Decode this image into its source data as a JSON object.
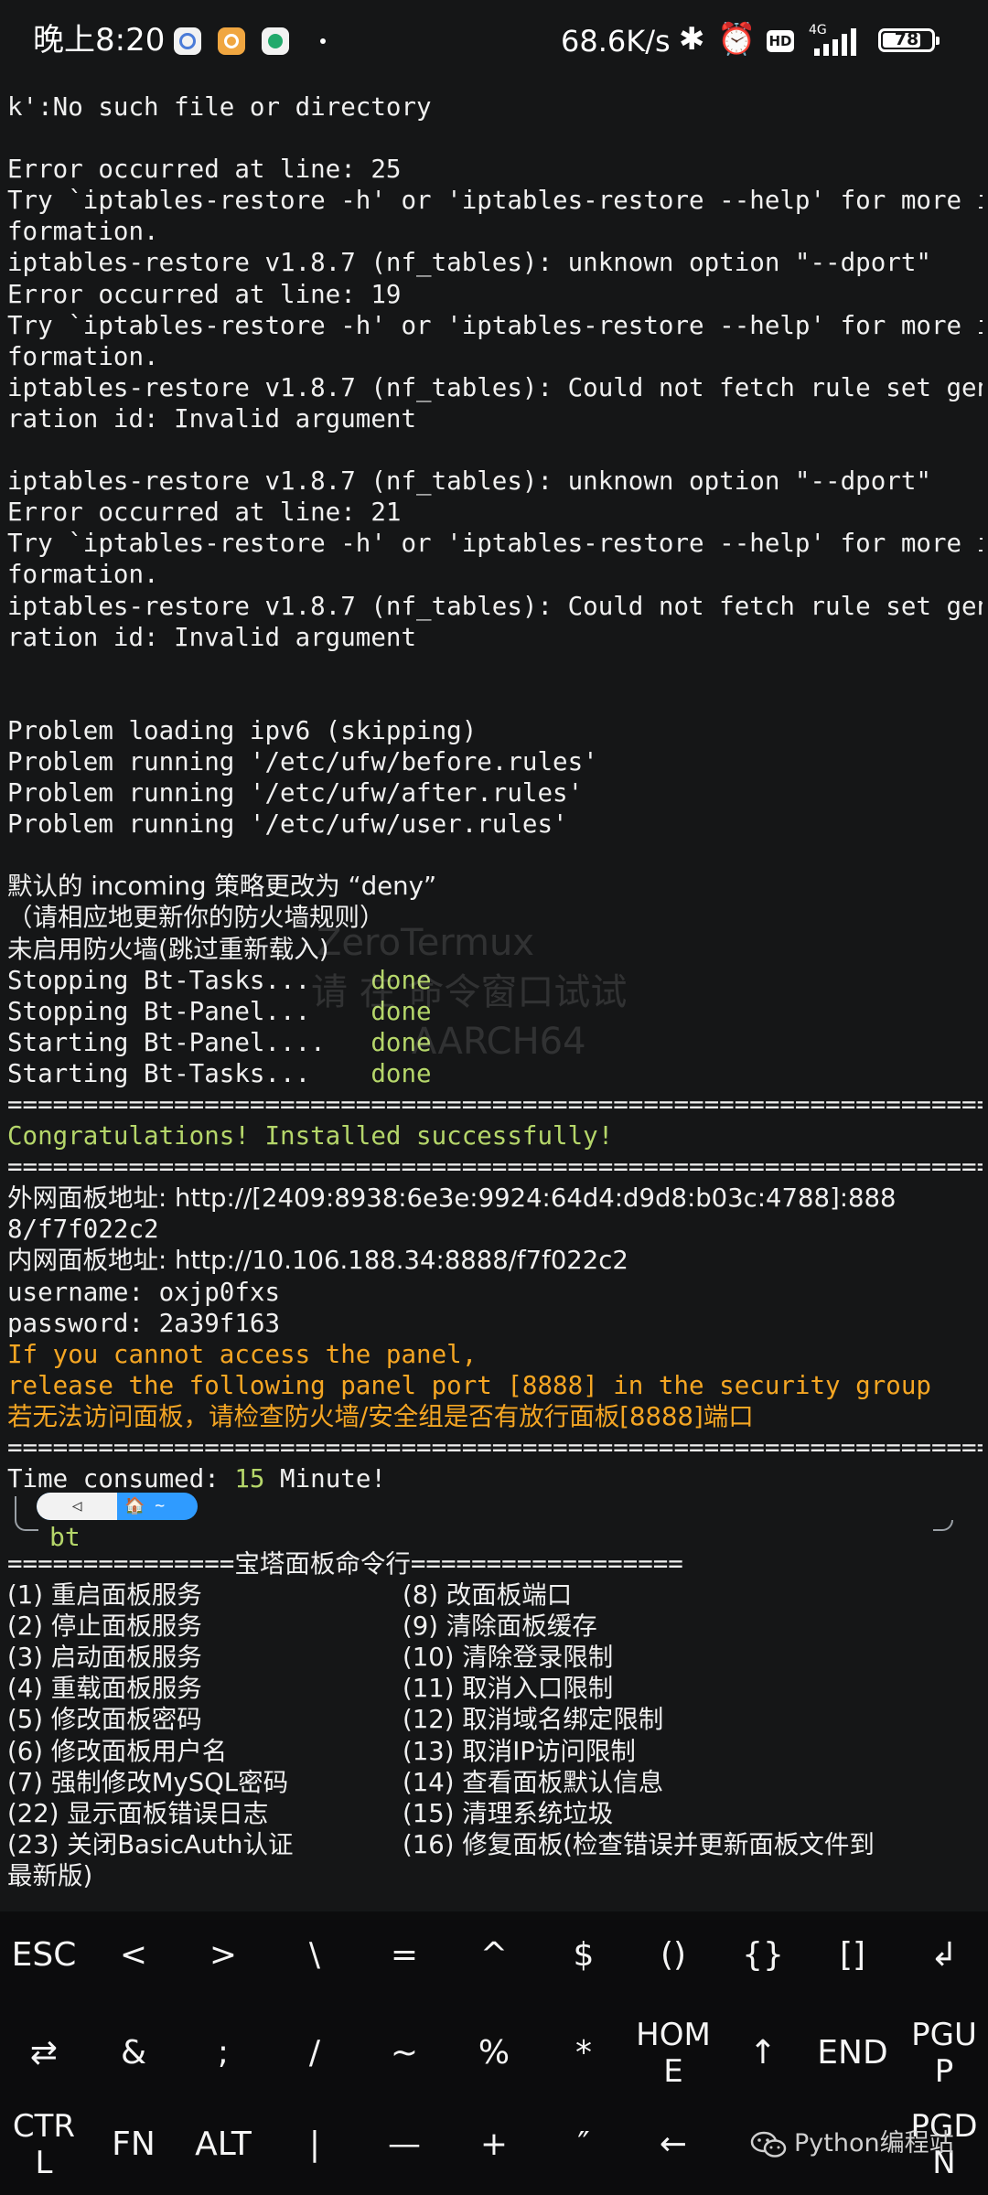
{
  "status_bar": {
    "time": "晚上8:20",
    "network_speed": "68.6K/s",
    "network_type": "4G",
    "battery": "78",
    "battery_level": 0.78,
    "icons": [
      "baidu-app-icon",
      "mail-app-icon",
      "china-mobile-app-icon",
      "bluetooth-icon",
      "alarm-icon",
      "hd-voice-icon",
      "signal-icon",
      "battery-icon"
    ]
  },
  "terminal": {
    "lines": [
      {
        "text": "k':No such file or directory",
        "color": "white"
      },
      {
        "text": "",
        "color": "white"
      },
      {
        "text": "Error occurred at line: 25",
        "color": "white"
      },
      {
        "text": "Try `iptables-restore -h' or 'iptables-restore --help' for more in",
        "color": "white"
      },
      {
        "text": "formation.",
        "color": "white"
      },
      {
        "text": "iptables-restore v1.8.7 (nf_tables): unknown option \"--dport\"",
        "color": "white"
      },
      {
        "text": "Error occurred at line: 19",
        "color": "white"
      },
      {
        "text": "Try `iptables-restore -h' or 'iptables-restore --help' for more in",
        "color": "white"
      },
      {
        "text": "formation.",
        "color": "white"
      },
      {
        "text": "iptables-restore v1.8.7 (nf_tables): Could not fetch rule set gene",
        "color": "white"
      },
      {
        "text": "ration id: Invalid argument",
        "color": "white"
      },
      {
        "text": "",
        "color": "white"
      },
      {
        "text": "iptables-restore v1.8.7 (nf_tables): unknown option \"--dport\"",
        "color": "white"
      },
      {
        "text": "Error occurred at line: 21",
        "color": "white"
      },
      {
        "text": "Try `iptables-restore -h' or 'iptables-restore --help' for more in",
        "color": "white"
      },
      {
        "text": "formation.",
        "color": "white"
      },
      {
        "text": "iptables-restore v1.8.7 (nf_tables): Could not fetch rule set gene",
        "color": "white"
      },
      {
        "text": "ration id: Invalid argument",
        "color": "white"
      },
      {
        "text": "",
        "color": "white"
      },
      {
        "text": "",
        "color": "white"
      },
      {
        "text": "Problem loading ipv6 (skipping)",
        "color": "white"
      },
      {
        "text": "Problem running '/etc/ufw/before.rules'",
        "color": "white"
      },
      {
        "text": "Problem running '/etc/ufw/after.rules'",
        "color": "white"
      },
      {
        "text": "Problem running '/etc/ufw/user.rules'",
        "color": "white"
      },
      {
        "text": "",
        "color": "white"
      },
      {
        "text": "默认的 incoming 策略更改为 “deny”",
        "color": "white"
      },
      {
        "text": "（请相应地更新你的防火墙规则）",
        "color": "white"
      },
      {
        "text": "未启用防火墙(跳过重新载入)",
        "color": "white"
      },
      {
        "text": "Stopping Bt-Tasks...    ",
        "color": "white",
        "suffix": "done"
      },
      {
        "text": "Stopping Bt-Panel...    ",
        "color": "white",
        "suffix": "done"
      },
      {
        "text": "Starting Bt-Panel....   ",
        "color": "white",
        "suffix": "done"
      },
      {
        "text": "Starting Bt-Tasks...    ",
        "color": "white",
        "suffix": "done"
      },
      {
        "text": "==================================================================",
        "color": "white"
      },
      {
        "text": "Congratulations! Installed successfully!",
        "color": "green"
      },
      {
        "text": "==================================================================",
        "color": "white"
      },
      {
        "text": "外网面板地址: http://[2409:8938:6e3e:9924:64d4:d9d8:b03c:4788]:888",
        "color": "white"
      },
      {
        "text": "8/f7f022c2",
        "color": "white"
      },
      {
        "text": "内网面板地址: http://10.106.188.34:8888/f7f022c2",
        "color": "white"
      },
      {
        "text": "username: oxjp0fxs",
        "color": "white"
      },
      {
        "text": "password: 2a39f163",
        "color": "white"
      },
      {
        "text": "If you cannot access the panel,",
        "color": "orange"
      },
      {
        "text": "release the following panel port [8888] in the security group",
        "color": "orange"
      },
      {
        "text": "若无法访问面板，请检查防火墙/安全组是否有放行面板[8888]端口",
        "color": "orange"
      },
      {
        "text": "==================================================================",
        "color": "white"
      },
      {
        "text": "Time consumed: ",
        "color": "white",
        "highlight": "15",
        "after": " Minute!"
      }
    ]
  },
  "watermark": {
    "line1": "ZeroTermux",
    "line2": "请 在 命令窗口试试",
    "line3": "AARCH64"
  },
  "prompt": {
    "segment1": "◁",
    "segment2": "🏠 ~",
    "command": "bt"
  },
  "menu": {
    "title_line": "===============宝塔面板命令行==================",
    "left": [
      "(1) 重启面板服务",
      "(2) 停止面板服务",
      "(3) 启动面板服务",
      "(4) 重载面板服务",
      "(5) 修改面板密码",
      "(6) 修改面板用户名",
      "(7) 强制修改MySQL密码",
      "(22) 显示面板错误日志",
      "(23) 关闭BasicAuth认证"
    ],
    "right": [
      "(8) 改面板端口",
      "(9) 清除面板缓存",
      "(10) 清除登录限制",
      "(11) 取消入口限制",
      "(12) 取消域名绑定限制",
      "(13) 取消IP访问限制",
      "(14) 查看面板默认信息",
      "(15) 清理系统垃圾",
      "(16) 修复面板(检查错误并更新面板文件到"
    ],
    "wrap_line": "最新版)"
  },
  "keyboard": {
    "row1": [
      "ESC",
      "<",
      ">",
      "\\",
      "=",
      "^",
      "$",
      "()",
      "{}",
      "[]",
      "↲"
    ],
    "row2": [
      "⇄",
      "&",
      ";",
      "/",
      "~",
      "%",
      "*",
      "HOM\nE",
      "↑",
      "END",
      "PGU\nP"
    ],
    "row3": [
      "CTR\nL",
      "FN",
      "ALT",
      "|",
      "—",
      "+",
      "″",
      "←",
      "",
      "",
      "PGD\nN"
    ]
  },
  "footer": {
    "watermark_text": "Python编程站"
  }
}
